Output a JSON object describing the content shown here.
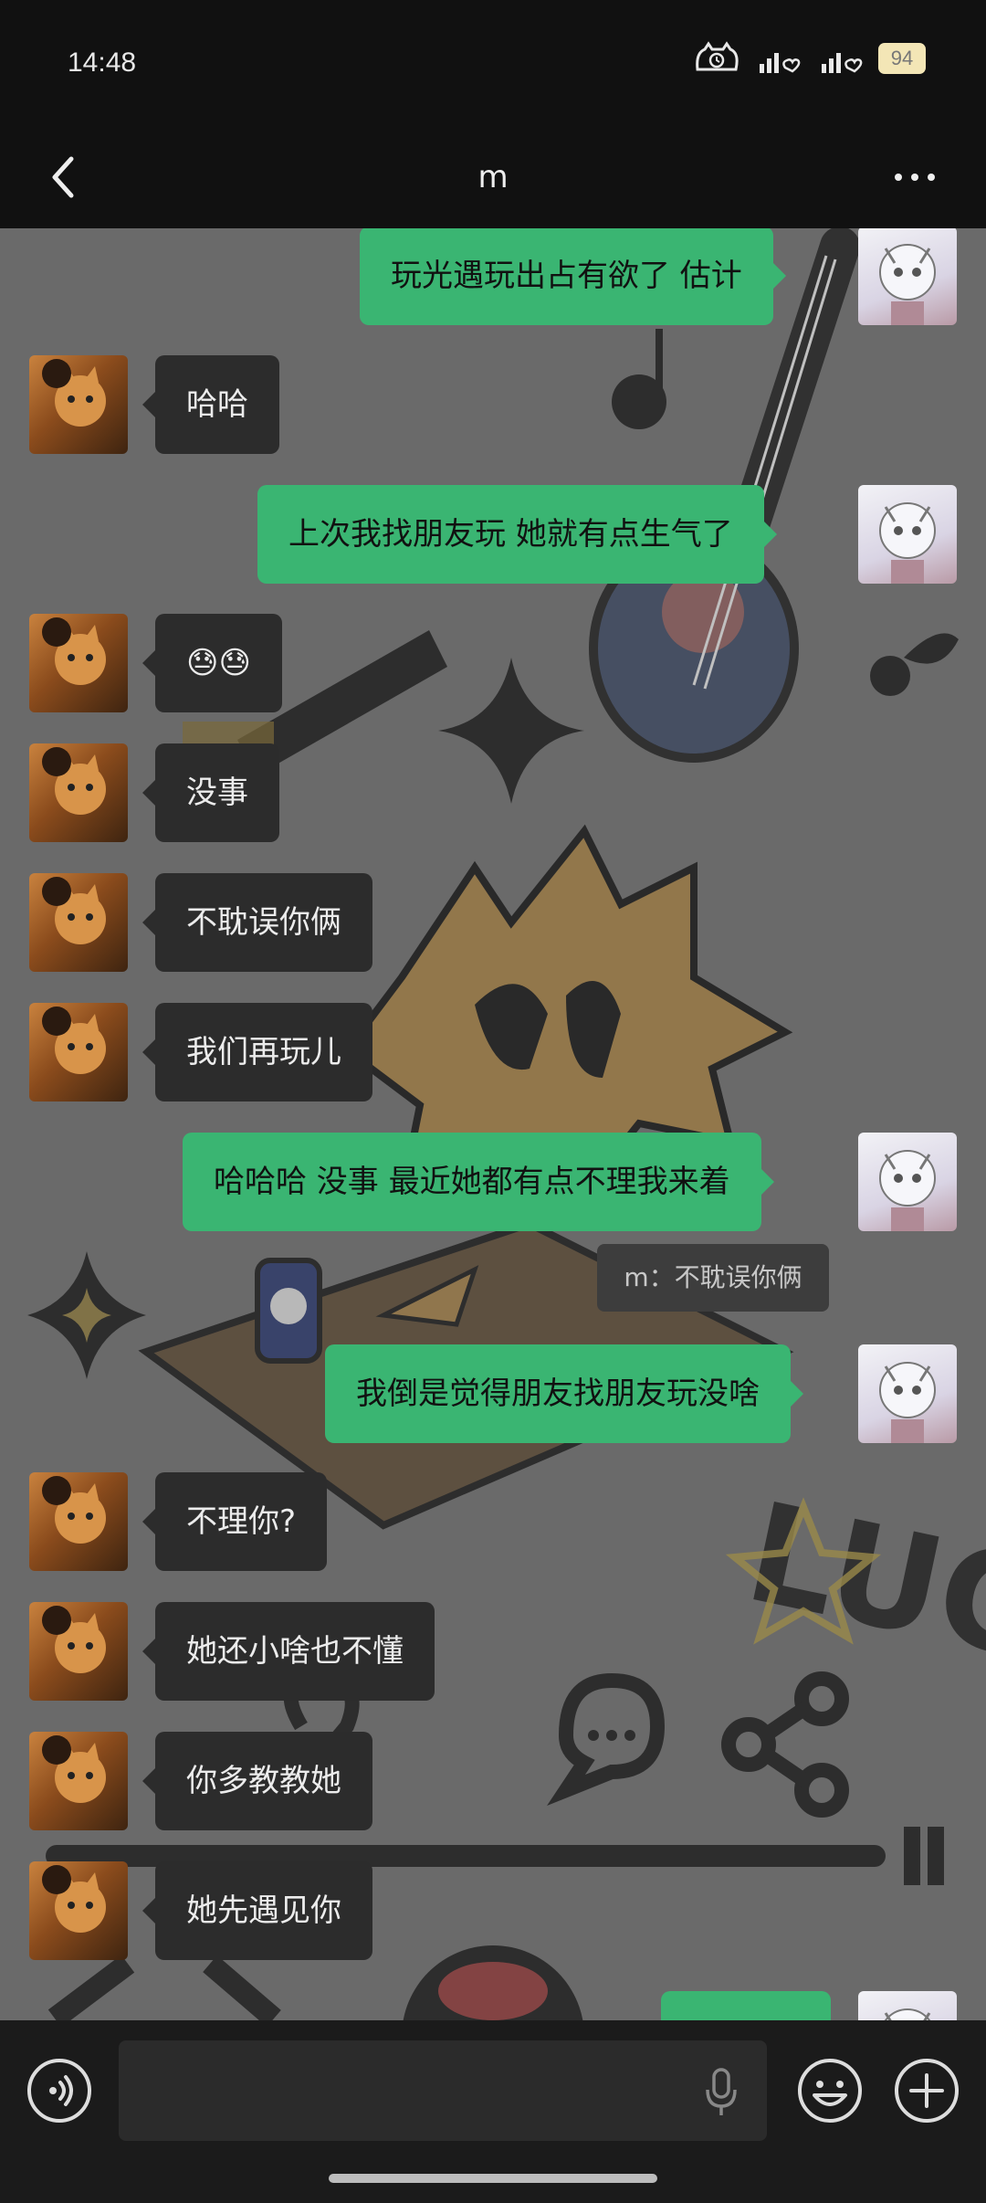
{
  "status_bar": {
    "time": "14:48",
    "battery": "94"
  },
  "header": {
    "title": "m"
  },
  "messages": [
    {
      "side": "out",
      "text": "玩光遇玩出占有欲了   估计"
    },
    {
      "side": "in",
      "text": "哈哈"
    },
    {
      "side": "out",
      "text": "上次我找朋友玩   她就有点生气了"
    },
    {
      "side": "in",
      "text": "😓😓"
    },
    {
      "side": "in",
      "text": "没事"
    },
    {
      "side": "in",
      "text": "不耽误你俩"
    },
    {
      "side": "in",
      "text": "我们再玩儿"
    },
    {
      "side": "out",
      "text": "哈哈哈  没事  最近她都有点不理我来着"
    },
    {
      "side": "out",
      "text": "我倒是觉得朋友找朋友玩没啥"
    },
    {
      "side": "in",
      "text": "不理你?"
    },
    {
      "side": "in",
      "text": "她还小啥也不懂"
    },
    {
      "side": "in",
      "text": "你多教教她"
    },
    {
      "side": "in",
      "text": "她先遇见你"
    },
    {
      "side": "out",
      "text": ""
    }
  ],
  "quote": {
    "text": "m：不耽误你俩"
  },
  "input": {
    "placeholder": ""
  }
}
